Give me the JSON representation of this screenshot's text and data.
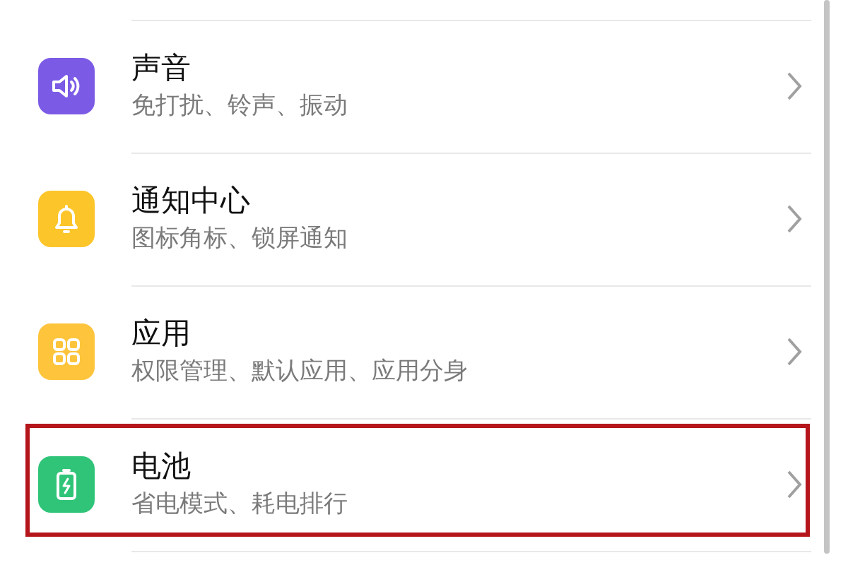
{
  "items": [
    {
      "kind": "sound",
      "color": "#7b5be6",
      "title": "声音",
      "subtitle": "免打扰、铃声、振动",
      "highlighted": false
    },
    {
      "kind": "bell",
      "color": "#fcc52a",
      "title": "通知中心",
      "subtitle": "图标角标、锁屏通知",
      "highlighted": false
    },
    {
      "kind": "grid",
      "color": "#fdc43c",
      "title": "应用",
      "subtitle": "权限管理、默认应用、应用分身",
      "highlighted": false
    },
    {
      "kind": "battery",
      "color": "#2fc478",
      "title": "电池",
      "subtitle": "省电模式、耗电排行",
      "highlighted": true
    }
  ]
}
